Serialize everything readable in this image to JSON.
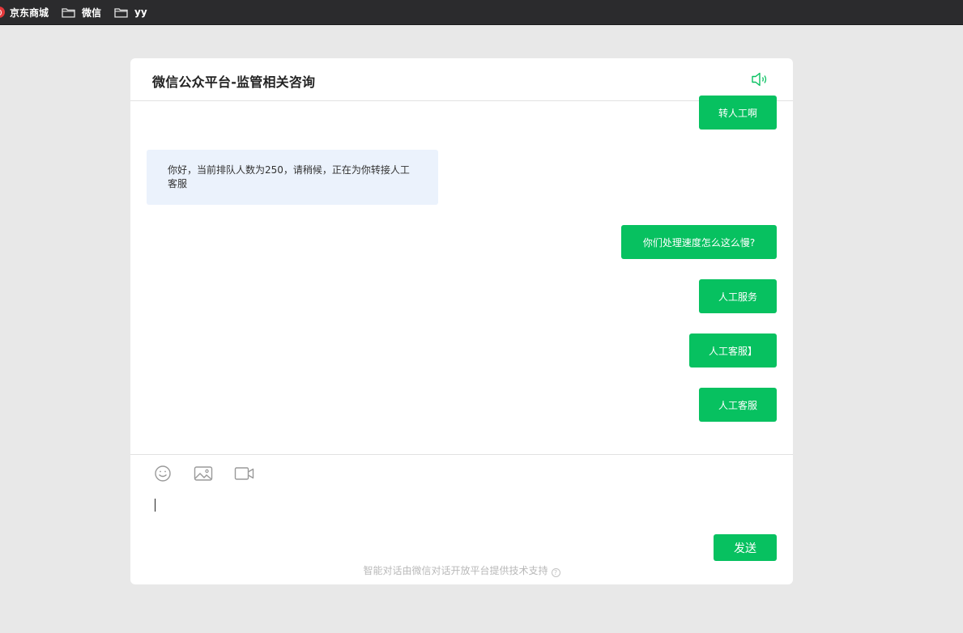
{
  "bookmarks": [
    {
      "label": "京东商城",
      "icon": "jd-logo-icon"
    },
    {
      "label": "微信",
      "icon": "folder-icon"
    },
    {
      "label": "yy",
      "icon": "folder-icon"
    }
  ],
  "chat": {
    "title": "微信公众平台-监管相关咨询",
    "speaker_icon": "speaker-icon",
    "messages": [
      {
        "from": "user",
        "text": "转人工啊"
      },
      {
        "from": "bot",
        "text": "你好，当前排队人数为250，请稍候，正在为你转接人工客服"
      },
      {
        "from": "user",
        "text": "你们处理速度怎么这么慢?"
      },
      {
        "from": "user",
        "text": "人工服务"
      },
      {
        "from": "user",
        "text": "人工客服】"
      },
      {
        "from": "user",
        "text": "人工客服"
      }
    ]
  },
  "input": {
    "tools": [
      "emoji-icon",
      "image-icon",
      "video-icon"
    ],
    "value": "",
    "send_label": "发送",
    "footer": "智能对话由微信对话开放平台提供技术支持",
    "help_glyph": "?"
  },
  "colors": {
    "accent": "#07c160",
    "bot_bubble": "#ebf2fc",
    "page_bg": "#e8e8e8",
    "bookmarks_bg": "#2b2b2d"
  }
}
